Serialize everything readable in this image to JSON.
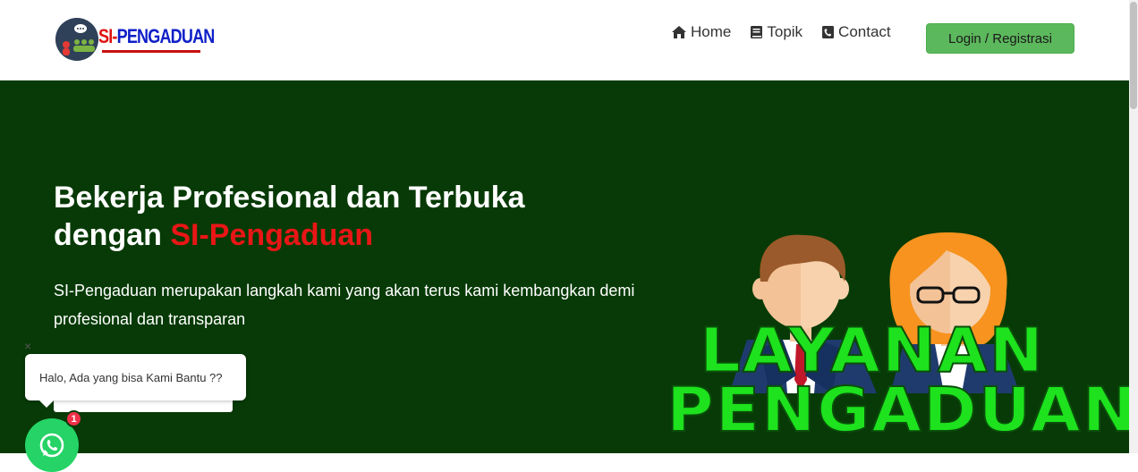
{
  "header": {
    "logo_text_prefix": "SI-",
    "logo_text_main": "PENGADUAN",
    "nav": [
      {
        "label": "Home",
        "icon": "home-icon"
      },
      {
        "label": "Topik",
        "icon": "book-icon"
      },
      {
        "label": "Contact",
        "icon": "contact-book-icon"
      }
    ],
    "login_label": "Login / Registrasi"
  },
  "hero": {
    "title_line1": "Bekerja Profesional dan Terbuka",
    "title_line2_prefix": "dengan ",
    "title_line2_accent": "SI-Pengaduan",
    "description": "SI-Pengaduan merupakan langkah kami yang akan terus kami kembangkan demi profesional dan transparan",
    "banner_line1": "LAYANAN",
    "banner_line2": "PENGADUAN"
  },
  "chat_widget": {
    "close_symbol": "×",
    "message": "Halo, Ada yang bisa Kami Bantu ??",
    "badge_count": "1",
    "icon": "whatsapp-icon"
  },
  "colors": {
    "hero_background": "#073a06",
    "accent_red": "#e81616",
    "login_button": "#5cb85c",
    "banner_green": "#1de21d",
    "whatsapp_green": "#25d366"
  }
}
